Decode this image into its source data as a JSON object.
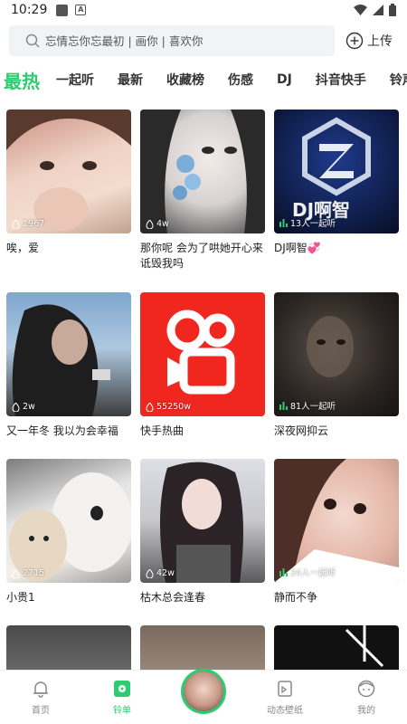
{
  "status_bar": {
    "time": "10:29"
  },
  "search": {
    "placeholder": "忘情忘你忘最初 | 画你 | 喜欢你"
  },
  "upload": {
    "label": "上传"
  },
  "tabs": [
    "最热",
    "一起听",
    "最新",
    "收藏榜",
    "伤感",
    "DJ",
    "抖音快手",
    "铃声"
  ],
  "cards": [
    {
      "title": "唉，爱",
      "count": "1967",
      "count_type": "flame"
    },
    {
      "title": "那你呢 会为了哄她开心来诋毁我吗",
      "count": "4w",
      "count_type": "flame"
    },
    {
      "title": "DJ啊智💞",
      "count": "13人一起听",
      "count_type": "bars",
      "logo_text": "DJ啊智"
    },
    {
      "title": "又一年冬  我以为会幸福",
      "count": "2w",
      "count_type": "flame"
    },
    {
      "title": "快手热曲",
      "count": "55250w",
      "count_type": "flame"
    },
    {
      "title": "深夜网抑云",
      "count": "81人一起听",
      "count_type": "bars"
    },
    {
      "title": "小贵1",
      "count": "2715",
      "count_type": "flame"
    },
    {
      "title": "枯木总会逢春",
      "count": "42w",
      "count_type": "flame"
    },
    {
      "title": "静而不争",
      "count": "24人一起听",
      "count_type": "bars"
    },
    {
      "title": "",
      "count": "",
      "count_type": ""
    },
    {
      "title": "",
      "count": "",
      "count_type": ""
    },
    {
      "title": "",
      "count": "",
      "count_type": ""
    }
  ],
  "bottom_nav": {
    "home": "首页",
    "ringtone": "铃单",
    "wallpaper": "动态壁纸",
    "mine": "我的"
  },
  "colors": {
    "accent": "#2ecc71"
  }
}
